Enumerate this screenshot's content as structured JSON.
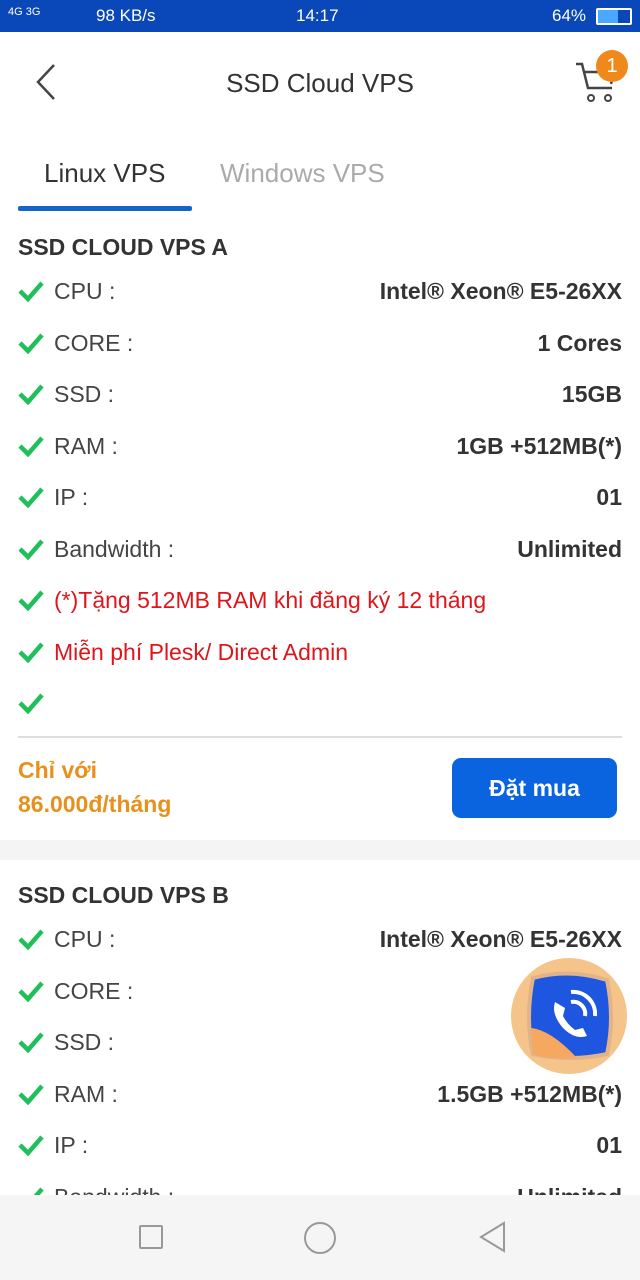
{
  "status_bar": {
    "network": "4G 3G",
    "speed": "98 KB/s",
    "time": "14:17",
    "battery": "64%"
  },
  "header": {
    "title": "SSD Cloud VPS",
    "cart_count": "1",
    "back_icon": "chevron-left-icon",
    "cart_icon": "cart-icon"
  },
  "tabs": [
    {
      "label": "Linux VPS",
      "active": true
    },
    {
      "label": "Windows VPS",
      "active": false
    }
  ],
  "colors": {
    "accent": "#0a64e0",
    "status_bar": "#0a47b8",
    "price": "#e8901c",
    "check": "#1fbf5a",
    "promo": "#e0141b"
  },
  "plans": [
    {
      "title": "SSD CLOUD VPS A",
      "specs": [
        {
          "label": "CPU :",
          "value": "Intel® Xeon® E5-26XX"
        },
        {
          "label": "CORE :",
          "value": "1 Cores"
        },
        {
          "label": "SSD :",
          "value": "15GB"
        },
        {
          "label": "RAM :",
          "value": "1GB +512MB(*)"
        },
        {
          "label": "IP :",
          "value": "01"
        },
        {
          "label": "Bandwidth :",
          "value": "Unlimited"
        },
        {
          "label": "(*)Tặng 512MB RAM khi đăng ký 12 tháng",
          "value": "",
          "promo": true
        },
        {
          "label": "Miễn phí Plesk/ Direct Admin",
          "value": "",
          "promo": true
        },
        {
          "label": "",
          "value": ""
        }
      ],
      "price_prefix": "Chỉ với",
      "price": "86.000đ/tháng",
      "buy_label": "Đặt mua"
    },
    {
      "title": "SSD CLOUD VPS B",
      "specs": [
        {
          "label": "CPU :",
          "value": "Intel® Xeon® E5-26XX"
        },
        {
          "label": "CORE :",
          "value": ""
        },
        {
          "label": "SSD :",
          "value": ""
        },
        {
          "label": "RAM :",
          "value": "1.5GB +512MB(*)"
        },
        {
          "label": "IP :",
          "value": "01"
        },
        {
          "label": "Bandwidth :",
          "value": "Unlimited"
        }
      ]
    }
  ]
}
